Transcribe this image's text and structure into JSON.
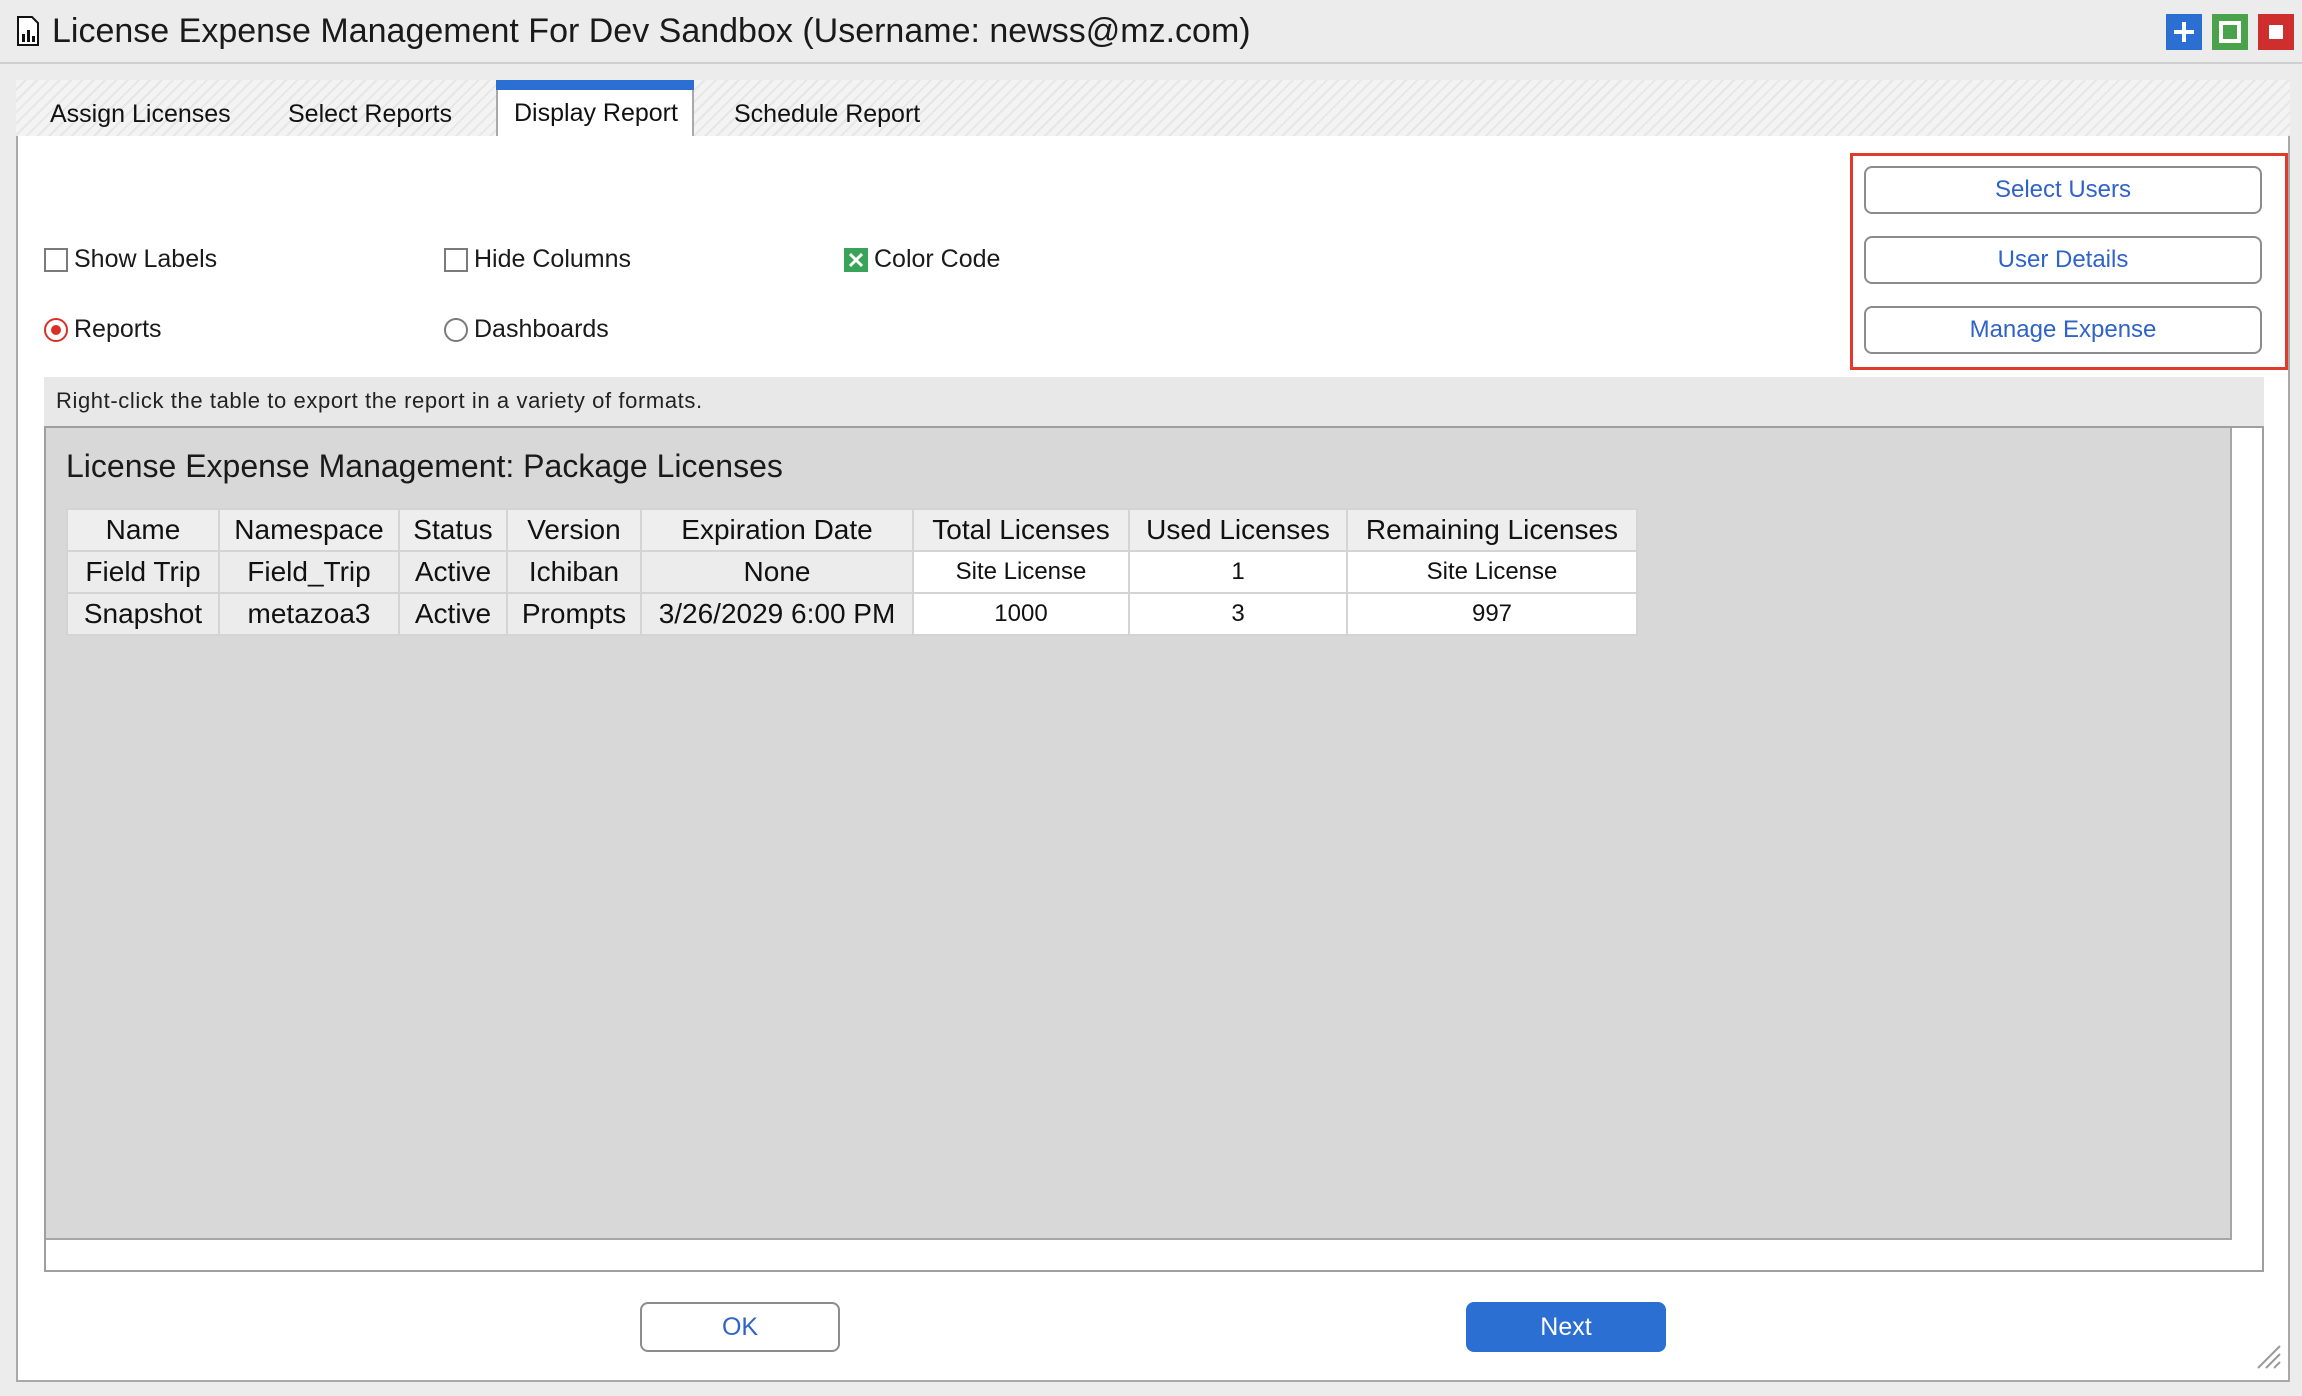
{
  "window": {
    "title": "License Expense Management For Dev Sandbox (Username: newss@mz.com)",
    "controls": [
      "add-icon",
      "maximize-icon",
      "close-icon"
    ]
  },
  "tabs": [
    {
      "label": "Assign Licenses",
      "active": false
    },
    {
      "label": "Select Reports",
      "active": false
    },
    {
      "label": "Display Report",
      "active": true
    },
    {
      "label": "Schedule Report",
      "active": false
    }
  ],
  "options": {
    "show_labels": {
      "label": "Show Labels",
      "checked": false
    },
    "hide_columns": {
      "label": "Hide Columns",
      "checked": false
    },
    "color_code": {
      "label": "Color Code",
      "checked": true
    },
    "reports": {
      "label": "Reports",
      "selected": true
    },
    "dashboards": {
      "label": "Dashboards",
      "selected": false
    }
  },
  "side_buttons": {
    "select_users": "Select Users",
    "user_details": "User Details",
    "manage_expense": "Manage Expense"
  },
  "info_text": "Right-click the table to export the report in a variety of formats.",
  "report": {
    "title": "License Expense Management: Package Licenses",
    "columns": [
      "Name",
      "Namespace",
      "Status",
      "Version",
      "Expiration Date",
      "Total Licenses",
      "Used Licenses",
      "Remaining Licenses"
    ],
    "rows": [
      [
        "Field Trip",
        "Field_Trip",
        "Active",
        "Ichiban",
        "None",
        "Site License",
        "1",
        "Site License"
      ],
      [
        "Snapshot",
        "metazoa3",
        "Active",
        "Prompts",
        "3/26/2029 6:00 PM",
        "1000",
        "3",
        "997"
      ]
    ]
  },
  "footer": {
    "ok_label": "OK",
    "next_label": "Next"
  },
  "colors": {
    "accent": "#2a6fd1",
    "highlight_border": "#e03a2b",
    "checked_green": "#3aa35a",
    "radio_red": "#d93025"
  }
}
